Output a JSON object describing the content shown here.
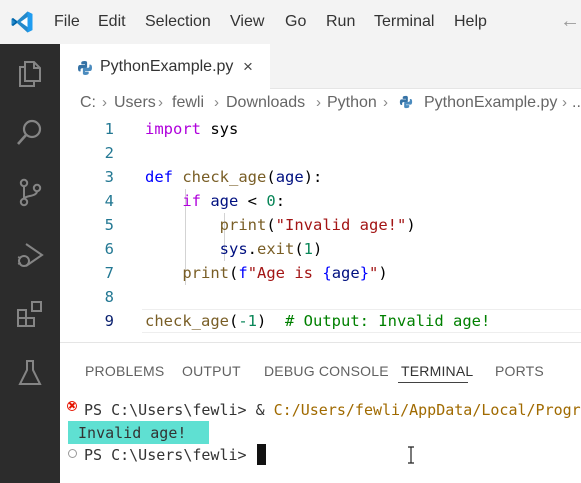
{
  "menu": {
    "items": [
      "File",
      "Edit",
      "Selection",
      "View",
      "Go",
      "Run",
      "Terminal",
      "Help"
    ]
  },
  "tab": {
    "label": "PythonExample.py",
    "close": "×"
  },
  "breadcrumb": {
    "items": [
      "C:",
      "Users",
      "fewli",
      "Downloads",
      "Python",
      "PythonExample.py",
      "..."
    ]
  },
  "editor": {
    "line_numbers": [
      "1",
      "2",
      "3",
      "4",
      "5",
      "6",
      "7",
      "8",
      "9"
    ],
    "lines": {
      "l1": {
        "kw": "import",
        "rest": " sys"
      },
      "l3": {
        "kw": "def",
        "fn": "check_age",
        "open": "(",
        "prm": "age",
        "close": "):"
      },
      "l4": {
        "kw": "if",
        "prm": "age",
        "op": " < ",
        "num": "0",
        "close": ":"
      },
      "l5": {
        "fn": "print",
        "open": "(",
        "str": "\"Invalid age!\"",
        "close": ")"
      },
      "l6": {
        "prm": "sys",
        "dot": ".",
        "fn": "exit",
        "open": "(",
        "num": "1",
        "close": ")"
      },
      "l7": {
        "fn": "print",
        "open": "(",
        "fpre": "f",
        "str1": "\"Age is ",
        "brace_open": "{",
        "prm": "age",
        "brace_close": "}",
        "str2": "\"",
        "close": ")"
      },
      "l9": {
        "fn": "check_age",
        "open": "(",
        "num": "-1",
        "close": ")",
        "cmt": "  # Output: Invalid age!"
      }
    }
  },
  "panel": {
    "tabs": [
      "PROBLEMS",
      "OUTPUT",
      "DEBUG CONSOLE",
      "TERMINAL",
      "PORTS"
    ],
    "active_tab": "TERMINAL"
  },
  "terminal": {
    "prompt1": "PS C:\\Users\\fewli> ",
    "command_amp": "& ",
    "command_path": "C:/Users/fewli/AppData/Local/Progr",
    "output": " Invalid age!",
    "prompt2": "PS C:\\Users\\fewli> "
  },
  "colors": {
    "accent": "#007acc",
    "highlight_output": "#5fe0d2",
    "error": "#e51400"
  }
}
